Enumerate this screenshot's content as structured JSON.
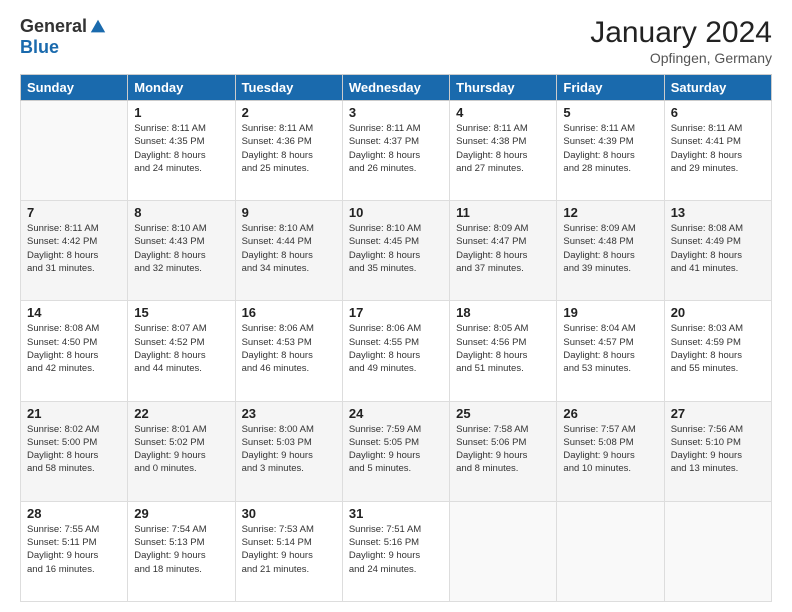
{
  "logo": {
    "general": "General",
    "blue": "Blue"
  },
  "header": {
    "month": "January 2024",
    "location": "Opfingen, Germany"
  },
  "weekdays": [
    "Sunday",
    "Monday",
    "Tuesday",
    "Wednesday",
    "Thursday",
    "Friday",
    "Saturday"
  ],
  "weeks": [
    [
      {
        "day": "",
        "info": ""
      },
      {
        "day": "1",
        "info": "Sunrise: 8:11 AM\nSunset: 4:35 PM\nDaylight: 8 hours\nand 24 minutes."
      },
      {
        "day": "2",
        "info": "Sunrise: 8:11 AM\nSunset: 4:36 PM\nDaylight: 8 hours\nand 25 minutes."
      },
      {
        "day": "3",
        "info": "Sunrise: 8:11 AM\nSunset: 4:37 PM\nDaylight: 8 hours\nand 26 minutes."
      },
      {
        "day": "4",
        "info": "Sunrise: 8:11 AM\nSunset: 4:38 PM\nDaylight: 8 hours\nand 27 minutes."
      },
      {
        "day": "5",
        "info": "Sunrise: 8:11 AM\nSunset: 4:39 PM\nDaylight: 8 hours\nand 28 minutes."
      },
      {
        "day": "6",
        "info": "Sunrise: 8:11 AM\nSunset: 4:41 PM\nDaylight: 8 hours\nand 29 minutes."
      }
    ],
    [
      {
        "day": "7",
        "info": ""
      },
      {
        "day": "8",
        "info": "Sunrise: 8:10 AM\nSunset: 4:43 PM\nDaylight: 8 hours\nand 32 minutes."
      },
      {
        "day": "9",
        "info": "Sunrise: 8:10 AM\nSunset: 4:44 PM\nDaylight: 8 hours\nand 34 minutes."
      },
      {
        "day": "10",
        "info": "Sunrise: 8:10 AM\nSunset: 4:45 PM\nDaylight: 8 hours\nand 35 minutes."
      },
      {
        "day": "11",
        "info": "Sunrise: 8:09 AM\nSunset: 4:47 PM\nDaylight: 8 hours\nand 37 minutes."
      },
      {
        "day": "12",
        "info": "Sunrise: 8:09 AM\nSunset: 4:48 PM\nDaylight: 8 hours\nand 39 minutes."
      },
      {
        "day": "13",
        "info": "Sunrise: 8:08 AM\nSunset: 4:49 PM\nDaylight: 8 hours\nand 41 minutes."
      }
    ],
    [
      {
        "day": "14",
        "info": "Sunrise: 8:08 AM\nSunset: 4:50 PM\nDaylight: 8 hours\nand 42 minutes."
      },
      {
        "day": "15",
        "info": "Sunrise: 8:07 AM\nSunset: 4:52 PM\nDaylight: 8 hours\nand 44 minutes."
      },
      {
        "day": "16",
        "info": "Sunrise: 8:06 AM\nSunset: 4:53 PM\nDaylight: 8 hours\nand 46 minutes."
      },
      {
        "day": "17",
        "info": "Sunrise: 8:06 AM\nSunset: 4:55 PM\nDaylight: 8 hours\nand 49 minutes."
      },
      {
        "day": "18",
        "info": "Sunrise: 8:05 AM\nSunset: 4:56 PM\nDaylight: 8 hours\nand 51 minutes."
      },
      {
        "day": "19",
        "info": "Sunrise: 8:04 AM\nSunset: 4:57 PM\nDaylight: 8 hours\nand 53 minutes."
      },
      {
        "day": "20",
        "info": "Sunrise: 8:03 AM\nSunset: 4:59 PM\nDaylight: 8 hours\nand 55 minutes."
      }
    ],
    [
      {
        "day": "21",
        "info": "Sunrise: 8:02 AM\nSunset: 5:00 PM\nDaylight: 8 hours\nand 58 minutes."
      },
      {
        "day": "22",
        "info": "Sunrise: 8:01 AM\nSunset: 5:02 PM\nDaylight: 9 hours\nand 0 minutes."
      },
      {
        "day": "23",
        "info": "Sunrise: 8:00 AM\nSunset: 5:03 PM\nDaylight: 9 hours\nand 3 minutes."
      },
      {
        "day": "24",
        "info": "Sunrise: 7:59 AM\nSunset: 5:05 PM\nDaylight: 9 hours\nand 5 minutes."
      },
      {
        "day": "25",
        "info": "Sunrise: 7:58 AM\nSunset: 5:06 PM\nDaylight: 9 hours\nand 8 minutes."
      },
      {
        "day": "26",
        "info": "Sunrise: 7:57 AM\nSunset: 5:08 PM\nDaylight: 9 hours\nand 10 minutes."
      },
      {
        "day": "27",
        "info": "Sunrise: 7:56 AM\nSunset: 5:10 PM\nDaylight: 9 hours\nand 13 minutes."
      }
    ],
    [
      {
        "day": "28",
        "info": "Sunrise: 7:55 AM\nSunset: 5:11 PM\nDaylight: 9 hours\nand 16 minutes."
      },
      {
        "day": "29",
        "info": "Sunrise: 7:54 AM\nSunset: 5:13 PM\nDaylight: 9 hours\nand 18 minutes."
      },
      {
        "day": "30",
        "info": "Sunrise: 7:53 AM\nSunset: 5:14 PM\nDaylight: 9 hours\nand 21 minutes."
      },
      {
        "day": "31",
        "info": "Sunrise: 7:51 AM\nSunset: 5:16 PM\nDaylight: 9 hours\nand 24 minutes."
      },
      {
        "day": "",
        "info": ""
      },
      {
        "day": "",
        "info": ""
      },
      {
        "day": "",
        "info": ""
      }
    ]
  ],
  "week7_day7_info": "Sunrise: 8:11 AM\nSunset: 4:42 PM\nDaylight: 8 hours\nand 31 minutes."
}
